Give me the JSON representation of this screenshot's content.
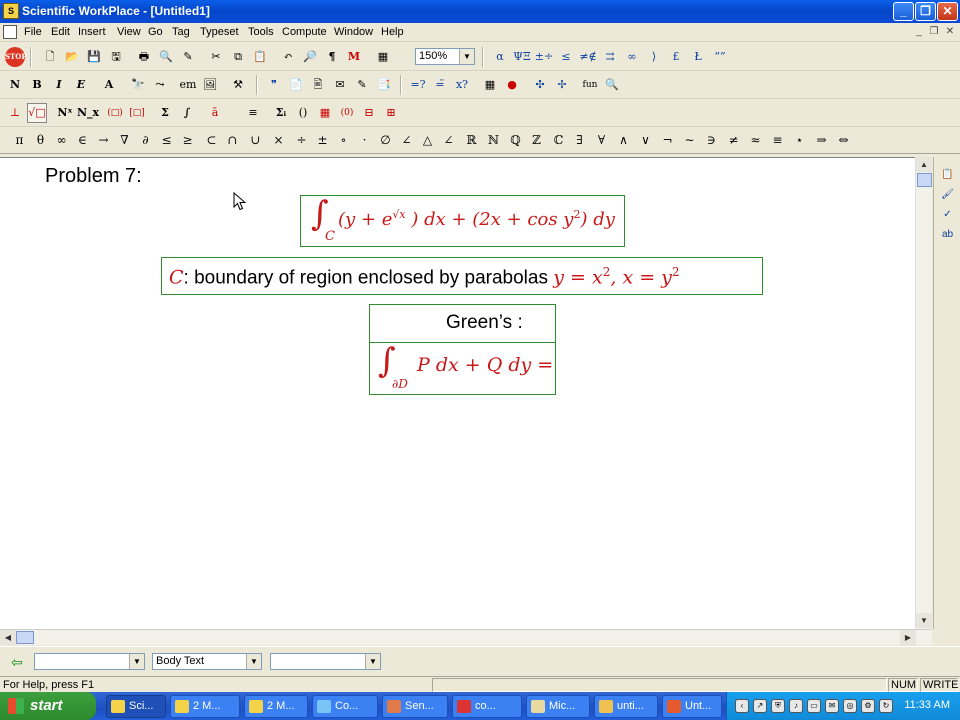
{
  "window": {
    "title": "Scientific WorkPlace - [Untitled1]",
    "app_icon": "swp-icon",
    "minimize": "_",
    "restore": "❐",
    "close": "✕"
  },
  "menu": {
    "items": [
      "File",
      "Edit",
      "Insert",
      "View",
      "Go",
      "Tag",
      "Typeset",
      "Tools",
      "Compute",
      "Window",
      "Help"
    ],
    "mdi_minimize": "_",
    "mdi_restore": "❐",
    "mdi_close": "✕"
  },
  "toolbar": {
    "zoom": "150%",
    "row1_icons": [
      "stop-icon",
      "new-icon",
      "open-icon",
      "save-icon",
      "save-as-icon",
      "print-icon",
      "preview-icon",
      "spell-icon",
      "cut-icon",
      "copy-icon",
      "paste-icon",
      "undo-icon",
      "find-icon",
      "paragraph-icon",
      "typeset-icon",
      "table-icon"
    ],
    "row1_glyphs": [
      "STOP",
      "🗋",
      "📂",
      "💾",
      "🖫",
      "🖶",
      "🔍",
      "✎",
      "✂",
      "⧉",
      "📋",
      "↶",
      "🔎",
      "¶",
      "M",
      "▦"
    ],
    "row1_right": [
      "α",
      "ΨΞ",
      "±÷",
      "≤",
      "≠∉",
      "⇉",
      "∞",
      "⟩",
      "£",
      "Ł",
      "“”"
    ],
    "row2": [
      "N",
      "B",
      "I",
      "E",
      "A",
      "🔭",
      "⤳",
      "em",
      "🖼",
      "⚒",
      "❞",
      "📄",
      "🖹",
      "✉",
      "✎",
      "📑",
      "=?",
      "=̈",
      "x?",
      "▦",
      "●",
      "✣",
      "✢",
      "fun",
      "🔍"
    ],
    "row3": [
      "⊥",
      "√□",
      "Nˣ",
      "N_x",
      "(□)",
      "[□]",
      "Σ",
      "∫",
      "ā",
      "≡",
      "Σᵢ",
      "()",
      "▦",
      "(0)",
      "⊟",
      "⊞"
    ]
  },
  "symbols": [
    "π",
    "θ",
    "∞",
    "∈",
    "→",
    "∇",
    "∂",
    "≤",
    "≥",
    "⊂",
    "∩",
    "∪",
    "×",
    "÷",
    "±",
    "∘",
    "·",
    "∅",
    "∠",
    "△",
    "∠",
    "ℝ",
    "ℕ",
    "ℚ",
    "ℤ",
    "ℂ",
    "∃",
    "∀",
    "∧",
    "∨",
    "¬",
    "∼",
    "∋",
    "≠",
    "≈",
    "≡",
    "⋆",
    "⇒",
    "⇔"
  ],
  "document": {
    "problem_heading": "Problem 7:",
    "integral_box": {
      "integral": "∫",
      "subscript": "C",
      "body_1": "(y + e",
      "exponent": "√x",
      "body_2": ") dx + (2x + cos y",
      "power": "2",
      "body_3": ") dy"
    },
    "boundary_box": {
      "curve": "C",
      "text": ": boundary of region enclosed by parabolas ",
      "eq1_lhs": "y = x",
      "eq1_pow": "2",
      "comma": ", ",
      "eq2_lhs": "x = y",
      "eq2_pow": "2"
    },
    "greens_box": {
      "title": "Green’s :",
      "integral": "∫",
      "subscript": "∂D",
      "body": "P dx + Q dy ="
    }
  },
  "side_panel": [
    "📋",
    "🖌",
    "✓",
    "ab"
  ],
  "tags": {
    "item_tag": "",
    "text_tag": "Body Text",
    "section_tag": ""
  },
  "status": {
    "help": "For Help, press F1",
    "num": "NUM",
    "write": "WRITE"
  },
  "taskbar": {
    "start": "start",
    "items": [
      "Sci...",
      "2 M...",
      "2 M...",
      "Co...",
      "Sen...",
      "co...",
      "Mic...",
      "unti...",
      "Unt..."
    ],
    "clock": "11:33 AM"
  }
}
